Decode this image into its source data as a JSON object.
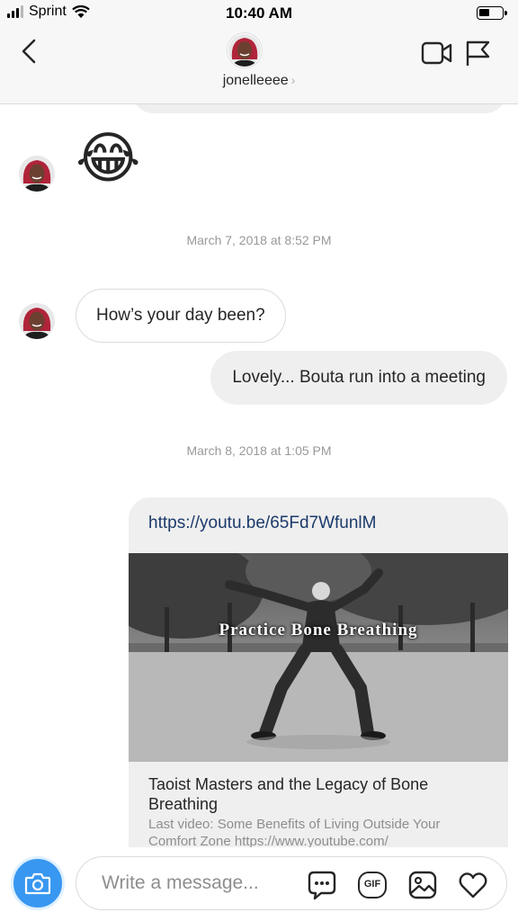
{
  "status_bar": {
    "carrier": "Sprint",
    "time": "10:40 AM"
  },
  "header": {
    "username": "jonelleeee",
    "chevron": "›",
    "icons": [
      "back-arrow-icon",
      "video-call-icon",
      "flag-icon"
    ]
  },
  "conversation": {
    "emoji_message": "😂",
    "timestamp_1": "March 7, 2018 at 8:52 PM",
    "incoming_message": "How’s your day been?",
    "outgoing_message": "Lovely... Bouta run into a meeting",
    "timestamp_2": "March 8, 2018 at 1:05 PM",
    "link_preview": {
      "url": "https://youtu.be/65Fd7WfunlM",
      "thumbnail_caption": "Practice Bone Breathing",
      "title": "Taoist Masters and the Legacy of Bone Breathing",
      "description": "Last video: Some Benefits of Living Outside Your Comfort Zone https://www.youtube.com/"
    }
  },
  "composer": {
    "placeholder": "Write a message...",
    "icons": [
      "camera-icon",
      "sticker-icon",
      "gif-icon",
      "gallery-icon",
      "heart-icon"
    ],
    "gif_label": "GIF"
  },
  "colors": {
    "accent_blue": "#3897f0",
    "link_blue": "#1b3a6b",
    "bubble_gray": "#efefef"
  }
}
